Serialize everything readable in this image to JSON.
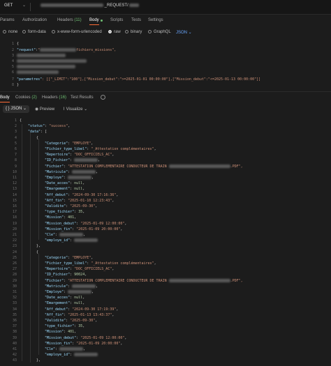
{
  "request": {
    "method": "GET",
    "url_visible": "_REQUEST/"
  },
  "request_tabs": [
    {
      "label": "Params",
      "count": ""
    },
    {
      "label": "Authorization",
      "count": ""
    },
    {
      "label": "Headers",
      "count": "(11)"
    },
    {
      "label": "Body",
      "count": ""
    },
    {
      "label": "Scripts",
      "count": ""
    },
    {
      "label": "Tests",
      "count": ""
    },
    {
      "label": "Settings",
      "count": ""
    }
  ],
  "body_types": [
    "none",
    "form-data",
    "x-www-form-urlencoded",
    "raw",
    "binary",
    "GraphQL"
  ],
  "body_format": "JSON",
  "request_body": {
    "line1": "{",
    "request_key": "\"request\"",
    "request_val_visible": "fichiers_missions\",",
    "params_key": "\"parametres\"",
    "params_val": ": [[\"_LIMIT\":\"100\"],[\"Mission_debut\":\">=2025-01-01 00:00:00\"],[\"Mission_debut\":\"<=2025-01-13 00:00:00\"]]",
    "close": "}"
  },
  "response_tabs": [
    {
      "label": "Body",
      "count": ""
    },
    {
      "label": "Cookies",
      "count": "(2)"
    },
    {
      "label": "Headers",
      "count": "(16)"
    },
    {
      "label": "Test Results",
      "count": ""
    }
  ],
  "response_toolbar": {
    "format": "{ } JSON",
    "preview": "Preview",
    "visualize": "Visualize"
  },
  "response_lines": [
    {
      "n": "1",
      "indent": 0,
      "t": "{"
    },
    {
      "n": "2",
      "indent": 1,
      "k": "\"status\"",
      "v": "\"success\"",
      "vt": "s",
      "comma": ","
    },
    {
      "n": "3",
      "indent": 1,
      "k": "\"data\"",
      "v": "[",
      "vt": "p"
    },
    {
      "n": "4",
      "indent": 2,
      "t": "{"
    },
    {
      "n": "5",
      "indent": 3,
      "k": "\"Categorie\"",
      "v": "\"EMPLOYE\"",
      "vt": "s",
      "comma": ","
    },
    {
      "n": "6",
      "indent": 3,
      "k": "\"Fichier_type_libel\"",
      "v": "\"_Attestation complémentaires\"",
      "vt": "s",
      "comma": ","
    },
    {
      "n": "7",
      "indent": 3,
      "k": "\"Repertoire\"",
      "v": "\"DOC_OFFICIELS_AC\"",
      "vt": "s",
      "comma": ","
    },
    {
      "n": "8",
      "indent": 3,
      "k": "\"ID_Fichier\"",
      "v": "",
      "vt": "b",
      "comma": ","
    },
    {
      "n": "9",
      "indent": 3,
      "k": "\"Fichier\"",
      "v": "\"ATTESTATION COMPLEMENTAIRE CONDUCTEUR DE TRAIN",
      "vt": "s",
      "tail": ".PDF\","
    },
    {
      "n": "10",
      "indent": 3,
      "k": "\"Matricule\"",
      "v": "",
      "vt": "b",
      "comma": ","
    },
    {
      "n": "11",
      "indent": 3,
      "k": "\"Employe\"",
      "v": "",
      "vt": "b",
      "comma": ","
    },
    {
      "n": "12",
      "indent": 3,
      "k": "\"Date_acces\"",
      "v": "null",
      "vt": "n",
      "comma": ","
    },
    {
      "n": "13",
      "indent": 3,
      "k": "\"Emargement\"",
      "v": "null",
      "vt": "n",
      "comma": ","
    },
    {
      "n": "14",
      "indent": 3,
      "k": "\"Aff_debut\"",
      "v": "\"2024-09-30 17:16:36\"",
      "vt": "s",
      "comma": ","
    },
    {
      "n": "15",
      "indent": 3,
      "k": "\"Aff_fin\"",
      "v": "\"2025-01-10 12:23:43\"",
      "vt": "s",
      "comma": ","
    },
    {
      "n": "16",
      "indent": 3,
      "k": "\"Validite\"",
      "v": "\"2025-09-30\"",
      "vt": "s",
      "comma": ","
    },
    {
      "n": "17",
      "indent": 3,
      "k": "\"type_fichier\"",
      "v": "35",
      "vt": "n",
      "comma": ","
    },
    {
      "n": "18",
      "indent": 3,
      "k": "\"Mission\"",
      "v": "401",
      "vt": "n",
      "comma": ","
    },
    {
      "n": "19",
      "indent": 3,
      "k": "\"Mission_debut\"",
      "v": "\"2025-01-09 12:00:00\"",
      "vt": "s",
      "comma": ","
    },
    {
      "n": "20",
      "indent": 3,
      "k": "\"Mission_fin\"",
      "v": "\"2025-01-09 20:00:00\"",
      "vt": "s",
      "comma": ","
    },
    {
      "n": "21",
      "indent": 3,
      "k": "\"Cle\"",
      "v": "",
      "vt": "b",
      "comma": ","
    },
    {
      "n": "22",
      "indent": 3,
      "k": "\"employe_id\"",
      "v": "",
      "vt": "b",
      "comma": ""
    },
    {
      "n": "23",
      "indent": 2,
      "t": "},"
    },
    {
      "n": "24",
      "indent": 2,
      "t": "{"
    },
    {
      "n": "25",
      "indent": 3,
      "k": "\"Categorie\"",
      "v": "\"EMPLOYE\"",
      "vt": "s",
      "comma": ","
    },
    {
      "n": "26",
      "indent": 3,
      "k": "\"Fichier_type_libel\"",
      "v": "\"_Attestation complémentaires\"",
      "vt": "s",
      "comma": ","
    },
    {
      "n": "27",
      "indent": 3,
      "k": "\"Repertoire\"",
      "v": "\"DOC_OFFICIELS_AC\"",
      "vt": "s",
      "comma": ","
    },
    {
      "n": "28",
      "indent": 3,
      "k": "\"ID_Fichier\"",
      "v": "90024",
      "vt": "n",
      "comma": ","
    },
    {
      "n": "29",
      "indent": 3,
      "k": "\"Fichier\"",
      "v": "\"ATTESTATION COMPLEMENTAIRE CONDUCTEUR DE TRAIN",
      "vt": "s",
      "tail": ".PDF\","
    },
    {
      "n": "30",
      "indent": 3,
      "k": "\"Matricule\"",
      "v": "",
      "vt": "b",
      "comma": ","
    },
    {
      "n": "31",
      "indent": 3,
      "k": "\"Employe\"",
      "v": "",
      "vt": "b",
      "comma": ","
    },
    {
      "n": "32",
      "indent": 3,
      "k": "\"Date_acces\"",
      "v": "null",
      "vt": "n",
      "comma": ","
    },
    {
      "n": "33",
      "indent": 3,
      "k": "\"Emargement\"",
      "v": "null",
      "vt": "n",
      "comma": ","
    },
    {
      "n": "34",
      "indent": 3,
      "k": "\"Aff_debut\"",
      "v": "\"2024-09-30 17:19:39\"",
      "vt": "s",
      "comma": ","
    },
    {
      "n": "35",
      "indent": 3,
      "k": "\"Aff_fin\"",
      "v": "\"2025-01-13 13:43:37\"",
      "vt": "s",
      "comma": ","
    },
    {
      "n": "36",
      "indent": 3,
      "k": "\"Validite\"",
      "v": "\"2025-09-30\"",
      "vt": "s",
      "comma": ","
    },
    {
      "n": "37",
      "indent": 3,
      "k": "\"type_fichier\"",
      "v": "35",
      "vt": "n",
      "comma": ","
    },
    {
      "n": "38",
      "indent": 3,
      "k": "\"Mission\"",
      "v": "401",
      "vt": "n",
      "comma": ","
    },
    {
      "n": "39",
      "indent": 3,
      "k": "\"Mission_debut\"",
      "v": "\"2025-01-09 12:00:00\"",
      "vt": "s",
      "comma": ","
    },
    {
      "n": "40",
      "indent": 3,
      "k": "\"Mission_fin\"",
      "v": "\"2025-01-09 20:00:00\"",
      "vt": "s",
      "comma": ","
    },
    {
      "n": "41",
      "indent": 3,
      "k": "\"Cle\"",
      "v": "",
      "vt": "b",
      "comma": ","
    },
    {
      "n": "42",
      "indent": 3,
      "k": "\"employe_id\"",
      "v": "",
      "vt": "b",
      "comma": ""
    },
    {
      "n": "43",
      "indent": 2,
      "t": "},"
    }
  ],
  "colors": {
    "accent": "#ff6c37",
    "count": "#6fbf73",
    "key": "#9cdcfe",
    "string": "#ce9178",
    "number": "#b5cea8",
    "json_select": "#6aa7ff"
  }
}
